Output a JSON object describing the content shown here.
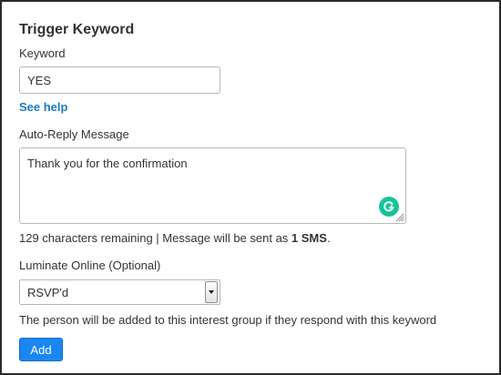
{
  "section": {
    "title": "Trigger Keyword"
  },
  "keyword": {
    "label": "Keyword",
    "value": "YES"
  },
  "help_link": {
    "label": "See help"
  },
  "auto_reply": {
    "label": "Auto-Reply Message",
    "value": "Thank you for the confirmation",
    "chars_remaining_text": "129 characters remaining | Message will be sent as ",
    "sms_count_text": "1 SMS",
    "sms_suffix": "."
  },
  "luminate": {
    "label": "Luminate Online (Optional)",
    "selected": "RSVP'd",
    "help_text": "The person will be added to this interest group if they respond with this keyword"
  },
  "actions": {
    "add_label": "Add"
  },
  "colors": {
    "link": "#1a7ac0",
    "button": "#1a86f0",
    "grammarly": "#15c39a"
  },
  "icons": {
    "grammarly": "grammarly-icon",
    "resize": "resize-handle-icon",
    "dropdown": "chevron-down-icon"
  }
}
